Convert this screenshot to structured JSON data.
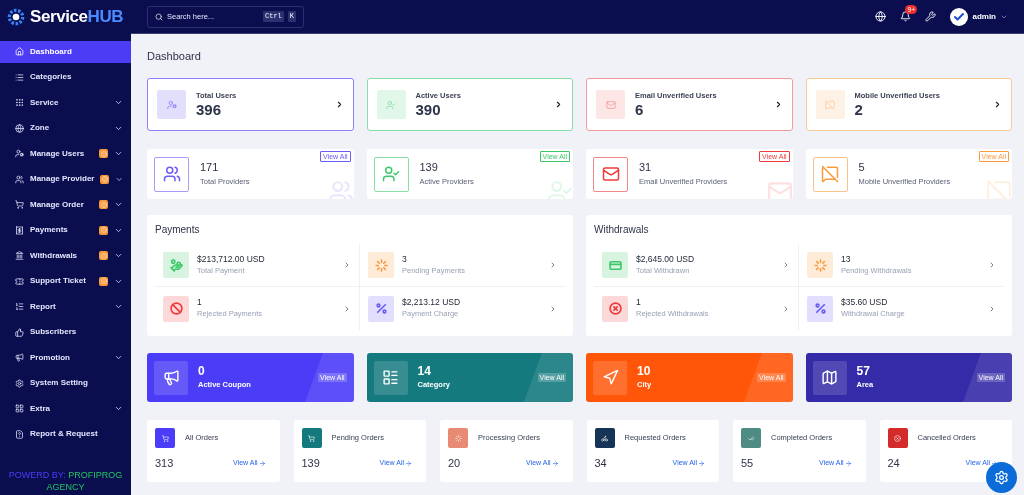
{
  "brand": {
    "name": "Service",
    "accent": "HUB"
  },
  "search": {
    "placeholder": "Search here...",
    "keys": [
      "Ctrl",
      "K"
    ]
  },
  "header": {
    "notification_count": "9+",
    "user": "admin"
  },
  "sidebar": {
    "items": [
      {
        "label": "Dashboard",
        "selected": true,
        "alert": false,
        "kind": "link"
      },
      {
        "label": "Categories",
        "selected": false,
        "alert": false,
        "kind": "link"
      },
      {
        "label": "Service",
        "selected": false,
        "alert": false,
        "kind": "group"
      },
      {
        "label": "Zone",
        "selected": false,
        "alert": false,
        "kind": "group"
      },
      {
        "label": "Manage Users",
        "selected": false,
        "alert": true,
        "kind": "group"
      },
      {
        "label": "Manage Provider",
        "selected": false,
        "alert": true,
        "kind": "group"
      },
      {
        "label": "Manage Order",
        "selected": false,
        "alert": true,
        "kind": "group"
      },
      {
        "label": "Payments",
        "selected": false,
        "alert": true,
        "kind": "group"
      },
      {
        "label": "Withdrawals",
        "selected": false,
        "alert": true,
        "kind": "group"
      },
      {
        "label": "Support Ticket",
        "selected": false,
        "alert": true,
        "kind": "group"
      },
      {
        "label": "Report",
        "selected": false,
        "alert": false,
        "kind": "group"
      },
      {
        "label": "Subscribers",
        "selected": false,
        "alert": false,
        "kind": "link"
      },
      {
        "label": "Promotion",
        "selected": false,
        "alert": false,
        "kind": "group"
      },
      {
        "label": "System Setting",
        "selected": false,
        "alert": false,
        "kind": "link"
      },
      {
        "label": "Extra",
        "selected": false,
        "alert": false,
        "kind": "group"
      },
      {
        "label": "Report & Request",
        "selected": false,
        "alert": false,
        "kind": "link"
      }
    ],
    "powered_by": {
      "label": "POWERD BY:",
      "name": "PROFIPROG AGENCY"
    }
  },
  "page_title": "Dashboard",
  "user_stats": [
    {
      "label": "Total Users",
      "value": "396",
      "color": "#8b7ef8"
    },
    {
      "label": "Active Users",
      "value": "390",
      "color": "#86e0a6"
    },
    {
      "label": "Email Unverified Users",
      "value": "6",
      "color": "#f59a9a"
    },
    {
      "label": "Mobile Unverified Users",
      "value": "2",
      "color": "#fcc999"
    }
  ],
  "provider_stats": [
    {
      "label": "Total Providers",
      "value": "171",
      "link": "View All",
      "color": "#6c5cf6"
    },
    {
      "label": "Active Providers",
      "value": "139",
      "link": "View All",
      "color": "#3cc86a"
    },
    {
      "label": "Email Unverified Providers",
      "value": "31",
      "link": "View All",
      "color": "#ef3b3b"
    },
    {
      "label": "Mobile Unverified Providers",
      "value": "5",
      "link": "View All",
      "color": "#fb9a3c"
    }
  ],
  "panels": [
    {
      "title": "Payments",
      "items": [
        {
          "value": "$213,712.00 USD",
          "label": "Total Payment",
          "color": "#3cc86a"
        },
        {
          "value": "3",
          "label": "Pending Payments",
          "color": "#fb9a3c"
        },
        {
          "value": "1",
          "label": "Rejected Payments",
          "color": "#ef3b3b"
        },
        {
          "value": "$2,213.12 USD",
          "label": "Payment Charge",
          "color": "#6c5cf6"
        }
      ]
    },
    {
      "title": "Withdrawals",
      "items": [
        {
          "value": "$2,645.00 USD",
          "label": "Total Withdrawn",
          "color": "#3cc86a"
        },
        {
          "value": "13",
          "label": "Pending Withdrawals",
          "color": "#fb9a3c"
        },
        {
          "value": "1",
          "label": "Rejected Withdrawals",
          "color": "#ef3b3b"
        },
        {
          "value": "$35.60 USD",
          "label": "Withdrawal Charge",
          "color": "#6c5cf6"
        }
      ]
    }
  ],
  "tiles": [
    {
      "value": "0",
      "label": "Active Coupon",
      "link": "View All",
      "color": "#4b3cf7"
    },
    {
      "value": "14",
      "label": "Category",
      "link": "View All",
      "color": "#157a7e"
    },
    {
      "value": "10",
      "label": "City",
      "link": "View All",
      "color": "#ff560a"
    },
    {
      "value": "57",
      "label": "Area",
      "link": "View All",
      "color": "#352aa7"
    }
  ],
  "orders": [
    {
      "label": "All Orders",
      "value": "313",
      "link": "View All",
      "color": "#4b3cf7"
    },
    {
      "label": "Pending Orders",
      "value": "139",
      "link": "View All",
      "color": "#157a7e"
    },
    {
      "label": "Processing Orders",
      "value": "20",
      "link": "View All",
      "color": "#e88a74"
    },
    {
      "label": "Requested Orders",
      "value": "34",
      "link": "View All",
      "color": "#163455"
    },
    {
      "label": "Completed Orders",
      "value": "55",
      "link": "View All",
      "color": "#4d8b83"
    },
    {
      "label": "Cancelled Orders",
      "value": "24",
      "link": "View All",
      "color": "#d32a2a"
    }
  ]
}
